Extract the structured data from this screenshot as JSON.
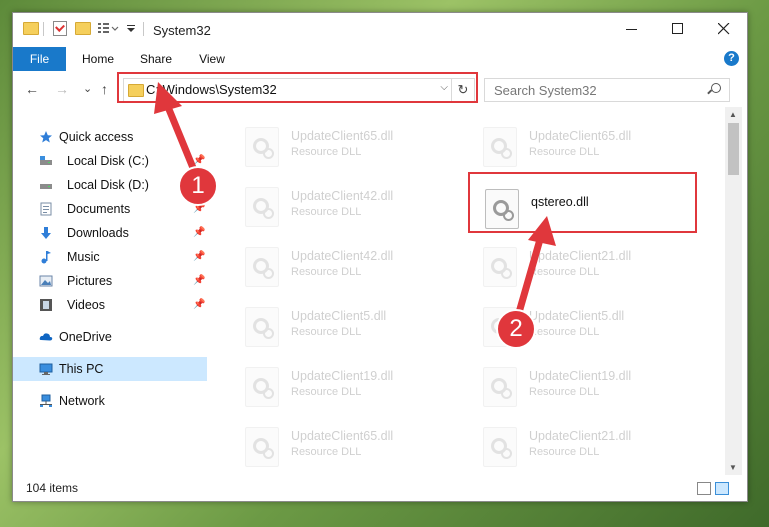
{
  "window": {
    "title": "System32"
  },
  "ribbon": {
    "file": "File",
    "tabs": [
      "Home",
      "Share",
      "View"
    ],
    "help": "?"
  },
  "nav_buttons": {
    "back": "←",
    "forward": "→",
    "recent": "⌄",
    "up": "↑"
  },
  "address": {
    "path": "C:\\Windows\\System32",
    "dropdown": "⌵",
    "refresh": "↻"
  },
  "search": {
    "placeholder": "Search System32"
  },
  "sidebar": {
    "quick_access": "Quick access",
    "items": [
      {
        "label": "Local Disk (C:)",
        "icon": "drive-icon",
        "pinned": true
      },
      {
        "label": "Local Disk (D:)",
        "icon": "drive-icon",
        "pinned": false
      },
      {
        "label": "Documents",
        "icon": "documents-icon",
        "pinned": true
      },
      {
        "label": "Downloads",
        "icon": "downloads-icon",
        "pinned": true
      },
      {
        "label": "Music",
        "icon": "music-icon",
        "pinned": true
      },
      {
        "label": "Pictures",
        "icon": "pictures-icon",
        "pinned": true
      },
      {
        "label": "Videos",
        "icon": "videos-icon",
        "pinned": true
      }
    ],
    "onedrive": "OneDrive",
    "this_pc": "This PC",
    "network": "Network"
  },
  "files": [
    {
      "name": "UpdateClient65.dll",
      "type": "Resource DLL",
      "faded": true
    },
    {
      "name": "UpdateClient65.dll",
      "type": "Resource DLL",
      "faded": true
    },
    {
      "name": "UpdateClient42.dll",
      "type": "Resource DLL",
      "faded": true
    },
    {
      "name": "qstereo.dll",
      "type": "",
      "faded": false
    },
    {
      "name": "UpdateClient42.dll",
      "type": "Resource DLL",
      "faded": true
    },
    {
      "name": "UpdateClient21.dll",
      "type": "Resource DLL",
      "faded": true
    },
    {
      "name": "UpdateClient5.dll",
      "type": "Resource DLL",
      "faded": true
    },
    {
      "name": "UpdateClient5.dll",
      "type": "Resource DLL",
      "faded": true
    },
    {
      "name": "UpdateClient19.dll",
      "type": "Resource DLL",
      "faded": true
    },
    {
      "name": "UpdateClient19.dll",
      "type": "Resource DLL",
      "faded": true
    },
    {
      "name": "UpdateClient65.dll",
      "type": "Resource DLL",
      "faded": true
    },
    {
      "name": "UpdateClient21.dll",
      "type": "Resource DLL",
      "faded": true
    }
  ],
  "status": {
    "count": "104 items"
  },
  "callouts": [
    "1",
    "2"
  ],
  "colors": {
    "accent": "#1979ca",
    "highlight": "#e0373c",
    "selection": "#cce8ff"
  }
}
